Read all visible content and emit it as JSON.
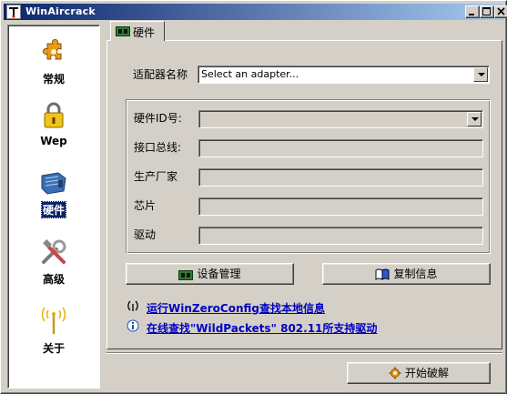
{
  "window": {
    "title": "WinAircrack",
    "controls": [
      "minimize",
      "maximize",
      "close"
    ]
  },
  "sidebar": {
    "items": [
      {
        "label": "常规",
        "icon": "puzzle-gear-icon",
        "selected": false
      },
      {
        "label": "Wep",
        "icon": "padlock-icon",
        "selected": false
      },
      {
        "label": "硬件",
        "icon": "network-card-icon",
        "selected": true
      },
      {
        "label": "高级",
        "icon": "tools-icon",
        "selected": false
      },
      {
        "label": "关于",
        "icon": "antenna-icon",
        "selected": false
      }
    ]
  },
  "tab": {
    "label": "硬件",
    "icon": "board-icon"
  },
  "adapter": {
    "label": "适配器名称",
    "selected": "Select an adapter..."
  },
  "info": {
    "hardware_id_label": "硬件ID号:",
    "interface_label": "接口总线:",
    "manufacturer_label": "生产厂家",
    "chip_label": "芯片",
    "driver_label": "驱动",
    "hardware_id_value": "",
    "interface_value": "",
    "manufacturer_value": "",
    "chip_value": "",
    "driver_value": ""
  },
  "buttons": {
    "device_manager": "设备管理",
    "copy_info": "复制信息",
    "start_crack": "开始破解"
  },
  "links": {
    "run_wzc": "运行WinZeroConfig查找本地信息",
    "online_search": "在线查找\"WildPackets\" 802.11所支持驱动"
  },
  "colors": {
    "face": "#d4d0c8",
    "title_start": "#0a246a",
    "title_end": "#a6caf0",
    "link": "#0000c0"
  }
}
